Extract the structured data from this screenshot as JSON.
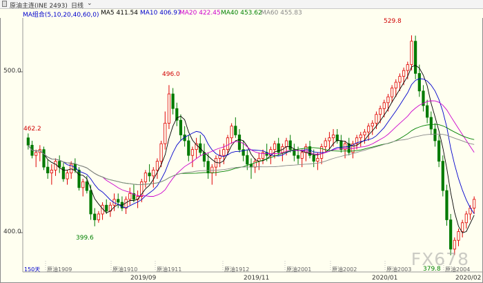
{
  "header": {
    "icon": "chart-tab-icon",
    "symbol": "原油主连(INE 2493)",
    "period": "日线",
    "period_dropdown_icon": "chevron-down-icon"
  },
  "ma_legend": {
    "group": "MA组合(5,10,20,40,60,0)",
    "items": [
      {
        "label": "MA5 411.54",
        "color": "#000000"
      },
      {
        "label": "MA10 406.97",
        "color": "#0000cc"
      },
      {
        "label": "MA20 422.45",
        "color": "#cc00cc"
      },
      {
        "label": "MA40 453.62",
        "color": "#008000"
      },
      {
        "label": "MA60 455.83",
        "color": "#888888"
      }
    ]
  },
  "axis": {
    "price_labels": [
      "500.0",
      "400.0"
    ],
    "volume_unit": "150天",
    "contract_labels": [
      "原油1909",
      "原油1910",
      "原油1911",
      "原油1912",
      "原油2001",
      "原油2002",
      "原油2003",
      "原油2004"
    ],
    "date_labels": [
      "2019/09",
      "2019/11",
      "2020/01",
      "2020/02"
    ]
  },
  "annotations": {
    "high": "529.8",
    "high_2": "496.0",
    "left_high": "462.2",
    "low": "399.6",
    "low_2": "379.8"
  },
  "watermark": "FX678",
  "chart_data": {
    "type": "candlestick",
    "title": "原油主连(INE 2493) 日线",
    "ylim": [
      375,
      540
    ],
    "series": [
      {
        "name": "MA5 411.54"
      },
      {
        "name": "MA10 406.97"
      },
      {
        "name": "MA20 422.45"
      },
      {
        "name": "MA40 453.62"
      },
      {
        "name": "MA60 455.83"
      }
    ],
    "ohlc": [
      [
        460,
        463,
        452,
        455
      ],
      [
        455,
        458,
        446,
        448
      ],
      [
        448,
        452,
        440,
        450
      ],
      [
        450,
        455,
        444,
        452
      ],
      [
        452,
        454,
        438,
        440
      ],
      [
        440,
        445,
        432,
        436
      ],
      [
        436,
        442,
        428,
        438
      ],
      [
        438,
        446,
        434,
        444
      ],
      [
        444,
        448,
        436,
        440
      ],
      [
        440,
        443,
        430,
        432
      ],
      [
        432,
        438,
        428,
        436
      ],
      [
        436,
        444,
        432,
        442
      ],
      [
        442,
        446,
        436,
        438
      ],
      [
        438,
        440,
        424,
        426
      ],
      [
        426,
        432,
        420,
        430
      ],
      [
        430,
        434,
        422,
        424
      ],
      [
        424,
        428,
        404,
        408
      ],
      [
        408,
        412,
        399.6,
        404
      ],
      [
        404,
        410,
        402,
        408
      ],
      [
        408,
        416,
        404,
        414
      ],
      [
        414,
        418,
        408,
        410
      ],
      [
        410,
        416,
        406,
        414
      ],
      [
        414,
        422,
        410,
        418
      ],
      [
        418,
        422,
        412,
        416
      ],
      [
        416,
        420,
        410,
        412
      ],
      [
        412,
        420,
        408,
        418
      ],
      [
        418,
        426,
        414,
        422
      ],
      [
        422,
        428,
        416,
        418
      ],
      [
        418,
        424,
        412,
        420
      ],
      [
        420,
        432,
        416,
        430
      ],
      [
        430,
        438,
        426,
        436
      ],
      [
        436,
        442,
        430,
        434
      ],
      [
        434,
        440,
        426,
        438
      ],
      [
        438,
        446,
        432,
        444
      ],
      [
        444,
        458,
        440,
        456
      ],
      [
        456,
        478,
        452,
        470
      ],
      [
        470,
        496,
        466,
        490
      ],
      [
        490,
        494,
        476,
        480
      ],
      [
        480,
        484,
        468,
        472
      ],
      [
        472,
        476,
        458,
        462
      ],
      [
        462,
        468,
        454,
        458
      ],
      [
        458,
        462,
        444,
        448
      ],
      [
        448,
        454,
        440,
        452
      ],
      [
        452,
        460,
        446,
        456
      ],
      [
        456,
        462,
        448,
        450
      ],
      [
        450,
        456,
        440,
        444
      ],
      [
        444,
        450,
        432,
        436
      ],
      [
        436,
        442,
        428,
        440
      ],
      [
        440,
        448,
        434,
        446
      ],
      [
        446,
        452,
        440,
        448
      ],
      [
        448,
        456,
        442,
        452
      ],
      [
        452,
        462,
        448,
        460
      ],
      [
        460,
        470,
        456,
        468
      ],
      [
        468,
        474,
        460,
        462
      ],
      [
        462,
        466,
        450,
        452
      ],
      [
        452,
        458,
        444,
        448
      ],
      [
        448,
        452,
        438,
        442
      ],
      [
        442,
        446,
        432,
        440
      ],
      [
        440,
        446,
        436,
        444
      ],
      [
        444,
        450,
        438,
        446
      ],
      [
        446,
        452,
        442,
        450
      ],
      [
        450,
        456,
        444,
        448
      ],
      [
        448,
        454,
        442,
        452
      ],
      [
        452,
        458,
        446,
        456
      ],
      [
        456,
        460,
        448,
        450
      ],
      [
        450,
        456,
        444,
        454
      ],
      [
        454,
        460,
        448,
        458
      ],
      [
        458,
        462,
        450,
        452
      ],
      [
        452,
        456,
        444,
        448
      ],
      [
        448,
        454,
        442,
        446
      ],
      [
        446,
        452,
        440,
        450
      ],
      [
        450,
        456,
        444,
        454
      ],
      [
        454,
        458,
        446,
        448
      ],
      [
        448,
        452,
        440,
        444
      ],
      [
        444,
        450,
        438,
        446
      ],
      [
        446,
        456,
        442,
        454
      ],
      [
        454,
        460,
        450,
        458
      ],
      [
        458,
        464,
        452,
        460
      ],
      [
        460,
        466,
        454,
        462
      ],
      [
        462,
        466,
        456,
        458
      ],
      [
        458,
        462,
        450,
        452
      ],
      [
        452,
        458,
        446,
        456
      ],
      [
        456,
        460,
        448,
        450
      ],
      [
        450,
        458,
        446,
        456
      ],
      [
        456,
        462,
        452,
        460
      ],
      [
        460,
        464,
        454,
        462
      ],
      [
        462,
        466,
        456,
        464
      ],
      [
        464,
        470,
        458,
        468
      ],
      [
        468,
        472,
        462,
        470
      ],
      [
        470,
        478,
        466,
        476
      ],
      [
        476,
        482,
        470,
        480
      ],
      [
        480,
        486,
        474,
        484
      ],
      [
        484,
        490,
        478,
        488
      ],
      [
        488,
        496,
        484,
        494
      ],
      [
        494,
        500,
        488,
        498
      ],
      [
        498,
        504,
        492,
        502
      ],
      [
        502,
        508,
        496,
        506
      ],
      [
        506,
        512,
        500,
        510
      ],
      [
        510,
        530,
        506,
        526
      ],
      [
        526,
        529.8,
        500,
        504
      ],
      [
        504,
        510,
        488,
        492
      ],
      [
        492,
        496,
        478,
        482
      ],
      [
        482,
        486,
        470,
        474
      ],
      [
        474,
        478,
        462,
        466
      ],
      [
        466,
        470,
        454,
        458
      ],
      [
        458,
        462,
        440,
        444
      ],
      [
        444,
        448,
        420,
        424
      ],
      [
        424,
        428,
        400,
        404
      ],
      [
        404,
        408,
        379.8,
        384
      ],
      [
        384,
        392,
        380,
        390
      ],
      [
        390,
        398,
        386,
        396
      ],
      [
        396,
        404,
        392,
        402
      ],
      [
        402,
        410,
        398,
        408
      ],
      [
        408,
        414,
        404,
        412
      ],
      [
        412,
        420,
        408,
        418
      ]
    ]
  }
}
